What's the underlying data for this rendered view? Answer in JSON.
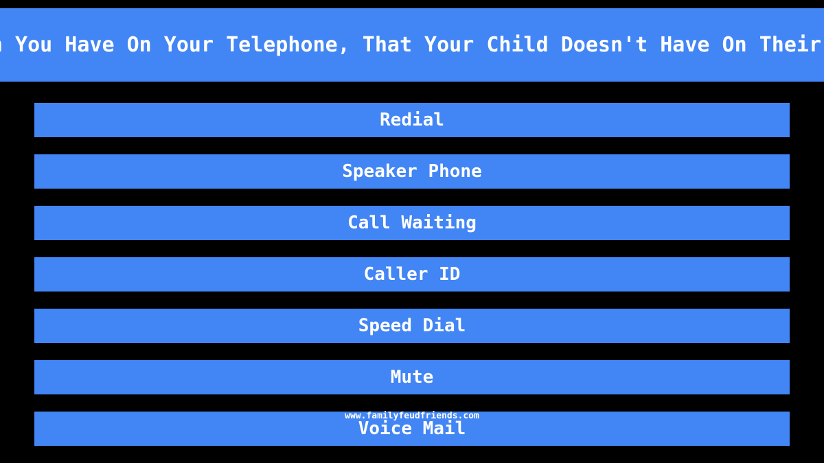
{
  "page": {
    "background_color": "#000000",
    "accent_color": "#4285f4",
    "text_color": "#ffffff"
  },
  "header": {
    "question": "Name A Function You Have On Your Telephone, That Your Child Doesn't Have On Their Tiny Toy Phone",
    "clipped": true
  },
  "answers": [
    {
      "label": "Redial"
    },
    {
      "label": "Speaker Phone"
    },
    {
      "label": "Call Waiting"
    },
    {
      "label": "Caller ID"
    },
    {
      "label": "Speed Dial"
    },
    {
      "label": "Mute"
    },
    {
      "label": "Voice Mail"
    }
  ],
  "watermark": {
    "text": "www.familyfeudfriends.com"
  }
}
